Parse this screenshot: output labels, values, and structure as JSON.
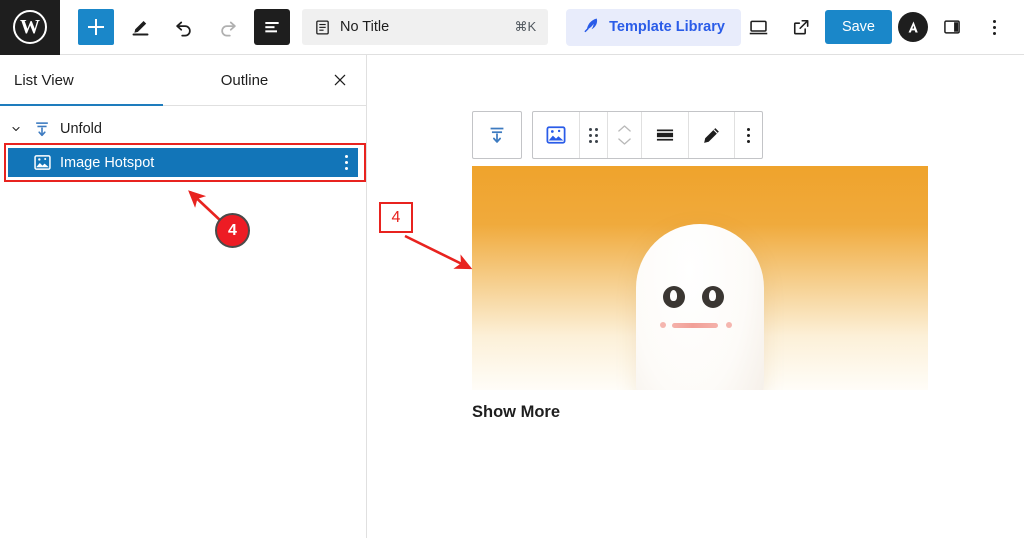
{
  "topbar": {
    "logo_icon": "wordpress-logo-icon",
    "logo_letter": "W",
    "add_block_icon": "plus-icon",
    "edit_mode_icon": "pencil-tool-icon",
    "undo_icon": "undo-arrow-icon",
    "redo_icon": "redo-arrow-icon",
    "list_view_icon": "list-view-icon",
    "document_icon": "document-icon",
    "title": "No Title",
    "title_shortcut": "⌘K",
    "template_library_icon": "template-library-icon",
    "template_library_label": "Template Library",
    "view_device_icon": "desktop-preview-icon",
    "open_external_icon": "external-link-icon",
    "save_label": "Save",
    "avatar_letter": "A",
    "sidebar_toggle_icon": "sidebar-panel-icon",
    "more_menu_icon": "kebab-menu-icon",
    "accent_blue": "#1a87c9",
    "template_blue": "#2a5ce8",
    "dark": "#1e1e1e"
  },
  "sidebar": {
    "tabs": [
      {
        "label": "List View",
        "active": true
      },
      {
        "label": "Outline",
        "active": false
      }
    ],
    "close_icon": "close-icon",
    "tree": [
      {
        "label": "Unfold",
        "icon": "unfold-down-icon",
        "chevron": "chevron-down-icon",
        "selected": false
      },
      {
        "label": "Image Hotspot",
        "icon": "image-hotspot-icon",
        "menu_icon": "kebab-menu-icon",
        "selected": true,
        "highlight_color": "#e8231f",
        "selected_bg": "#1275b8"
      }
    ]
  },
  "annotations": [
    {
      "id": "circle-4",
      "label": "4",
      "shape": "circle",
      "color": "#ed1c24"
    },
    {
      "id": "square-4",
      "label": "4",
      "shape": "square",
      "color": "#e8231f"
    }
  ],
  "canvas": {
    "block_toolbar": [
      {
        "name": "unfold-block-button",
        "icon": "unfold-down-icon"
      },
      {
        "name": "block-type-button",
        "icon": "image-hotspot-icon"
      },
      {
        "name": "drag-handle",
        "icon": "drag-dots-icon"
      },
      {
        "name": "move-updown-button",
        "icon": "chevron-up-down-icon"
      },
      {
        "name": "align-button",
        "icon": "align-wide-icon"
      },
      {
        "name": "edit-button",
        "icon": "pencil-icon"
      },
      {
        "name": "block-options-button",
        "icon": "kebab-menu-icon"
      }
    ],
    "image": {
      "alt": "ghost-character-illustration",
      "gradient_top": "#efa32c",
      "gradient_bottom": "#fffdf8"
    },
    "show_more_label": "Show More"
  }
}
